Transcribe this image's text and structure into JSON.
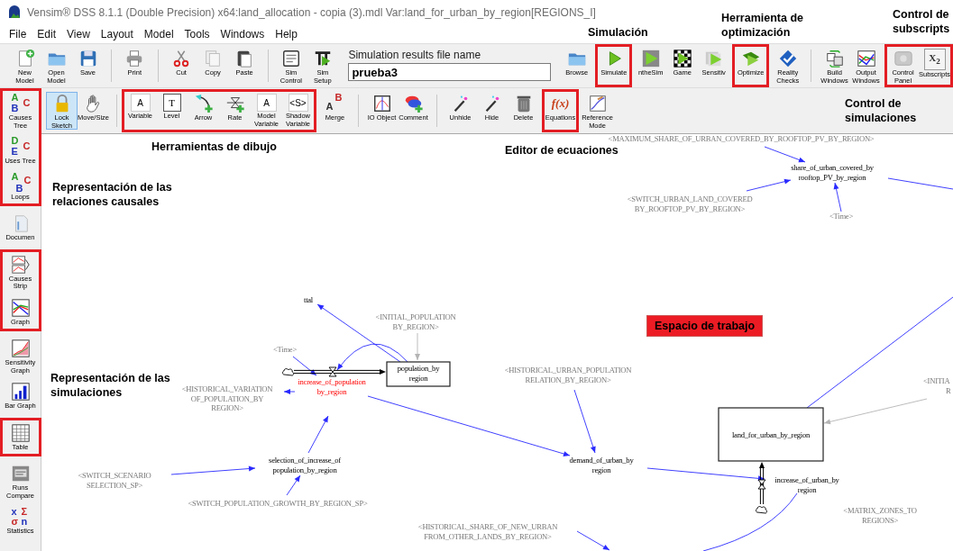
{
  "window": {
    "title": "Vensim® DSS 8.1.1 (Double Precision) x64:land_allocation - copia (3).mdl Var:land_for_urban_by_region[REGIONS_I]"
  },
  "menu": [
    "File",
    "Edit",
    "View",
    "Layout",
    "Model",
    "Tools",
    "Windows",
    "Help"
  ],
  "main_toolbar": {
    "left_groups": [
      {
        "highlighted": false,
        "items": [
          {
            "label": "New Model"
          },
          {
            "label": "Open Model"
          },
          {
            "label": "Save"
          }
        ]
      },
      {
        "highlighted": false,
        "items": [
          {
            "label": "Print"
          }
        ]
      },
      {
        "highlighted": false,
        "items": [
          {
            "label": "Cut"
          },
          {
            "label": "Copy"
          },
          {
            "label": "Paste"
          }
        ]
      },
      {
        "highlighted": false,
        "items": [
          {
            "label": "Sim Control"
          },
          {
            "label": "Sim Setup"
          }
        ]
      }
    ],
    "results_file": {
      "label": "Simulation results file name",
      "value": "prueba3"
    },
    "right_groups": [
      {
        "highlighted": false,
        "items": [
          {
            "label": "Browse"
          }
        ]
      },
      {
        "highlighted": true,
        "items": [
          {
            "label": "Simulate"
          }
        ]
      },
      {
        "highlighted": false,
        "items": [
          {
            "label": "ntheSim"
          },
          {
            "label": "Game"
          },
          {
            "label": "Sensitiv"
          }
        ]
      },
      {
        "highlighted": true,
        "items": [
          {
            "label": "Optimize"
          }
        ]
      },
      {
        "highlighted": false,
        "items": [
          {
            "label": "Reality Checks"
          }
        ]
      },
      {
        "highlighted": false,
        "items": [
          {
            "label": "Build Windows"
          },
          {
            "label": "Output Windows"
          }
        ]
      },
      {
        "highlighted": true,
        "items": [
          {
            "label": "Control Panel"
          },
          {
            "label": "Subscripts",
            "glyph": [
              "X$_{2}$"
            ]
          }
        ]
      }
    ]
  },
  "sketch_toolbar": {
    "groups": [
      {
        "highlighted": false,
        "items": [
          {
            "label": "Lock Sketch",
            "selected": true
          },
          {
            "label": "Move/Size",
            "selected": false
          }
        ]
      },
      {
        "highlighted": true,
        "items": [
          {
            "label": "Variable",
            "selected": false,
            "glyph": [
              "A"
            ]
          },
          {
            "label": "Level",
            "selected": false,
            "glyph": [
              "T"
            ]
          },
          {
            "label": "Arrow",
            "selected": false
          },
          {
            "label": "Rate",
            "selected": false
          },
          {
            "label": "Model Variable",
            "selected": false,
            "glyph": [
              "A"
            ]
          },
          {
            "label": "Shadow Variable",
            "selected": false,
            "glyph": [
              "<S>"
            ]
          }
        ]
      },
      {
        "highlighted": false,
        "items": [
          {
            "label": "Merge",
            "selected": false,
            "glyph": [
              "A",
              "B"
            ]
          }
        ]
      },
      {
        "highlighted": false,
        "items": [
          {
            "label": "IO Object",
            "selected": false
          },
          {
            "label": "Comment",
            "selected": false
          }
        ]
      },
      {
        "highlighted": false,
        "items": [
          {
            "label": "Unhide",
            "selected": false
          },
          {
            "label": "Hide",
            "selected": false
          },
          {
            "label": "Delete",
            "selected": false
          }
        ]
      },
      {
        "highlighted": true,
        "items": [
          {
            "label": "Equations",
            "selected": false,
            "glyph": [
              "f(x)"
            ]
          }
        ]
      },
      {
        "highlighted": false,
        "items": [
          {
            "label": "Reference Mode",
            "selected": false
          }
        ]
      }
    ]
  },
  "analysis_toolbar": {
    "groups": [
      {
        "highlighted": true,
        "items": [
          {
            "label": "Causes Tree",
            "glyph": [
              "A",
              "B",
              "C"
            ]
          },
          {
            "label": "Uses Tree",
            "glyph": [
              "D",
              "E",
              "C"
            ]
          },
          {
            "label": "Loops",
            "glyph": [
              "A",
              "B",
              "C"
            ]
          }
        ]
      },
      {
        "highlighted": false,
        "items": [
          {
            "label": "Documen"
          }
        ]
      },
      {
        "highlighted": true,
        "items": [
          {
            "label": "Causes Strip"
          },
          {
            "label": "Graph"
          }
        ]
      },
      {
        "highlighted": false,
        "items": [
          {
            "label": "Sensitivity Graph"
          },
          {
            "label": "Bar Graph"
          }
        ]
      },
      {
        "highlighted": true,
        "items": [
          {
            "label": "Table"
          }
        ]
      },
      {
        "highlighted": false,
        "items": [
          {
            "label": "Runs Compare"
          },
          {
            "label": "Statistics",
            "glyph": [
              "x",
              "Σ",
              "σ",
              "n"
            ]
          }
        ]
      }
    ]
  },
  "sketch": {
    "nodes": [
      {
        "kind": "shadow",
        "highlighted": false,
        "lines": [
          "<MAXIMUM_SHARE_OF_URBAN_COVERED_BY_ROOFTOP_PV_BY_REGION>"
        ]
      },
      {
        "kind": "aux",
        "highlighted": false,
        "lines": [
          "share_of_urban_covered_by",
          "rooftop_PV_by_region"
        ]
      },
      {
        "kind": "shadow",
        "highlighted": false,
        "lines": [
          "<SWITCH_URBAN_LAND_COVERED",
          "BY_ROOFTOP_PV_BY_REGION>"
        ]
      },
      {
        "kind": "shadow",
        "highlighted": false,
        "lines": [
          "<Time>"
        ]
      },
      {
        "kind": "aux",
        "highlighted": false,
        "lines": [
          "ttal"
        ]
      },
      {
        "kind": "shadow",
        "highlighted": false,
        "lines": [
          "<INITIAL_POPULATION",
          "BY_REGION>"
        ]
      },
      {
        "kind": "shadow",
        "highlighted": false,
        "lines": [
          "<Time>"
        ]
      },
      {
        "kind": "shadow",
        "highlighted": false,
        "lines": [
          "<HISTORICAL_VARIATION",
          "OF_POPULATION_BY",
          "REGION>"
        ]
      },
      {
        "kind": "rate",
        "highlighted": true,
        "lines": [
          "increase_of_population",
          "by_region"
        ]
      },
      {
        "kind": "level",
        "highlighted": false,
        "lines": [
          "population_by",
          "region"
        ]
      },
      {
        "kind": "shadow",
        "highlighted": false,
        "lines": [
          "<HISTORICAL_URBAN_POPULATION",
          "RELATION_BY_REGION>"
        ]
      },
      {
        "kind": "shadow",
        "highlighted": false,
        "lines": [
          "<INITIA",
          "R"
        ]
      },
      {
        "kind": "level",
        "highlighted": false,
        "lines": [
          "land_for_urban_by_region"
        ]
      },
      {
        "kind": "shadow",
        "highlighted": false,
        "lines": [
          "<SWITCH_SCENARIO",
          "SELECTION_SP>"
        ]
      },
      {
        "kind": "aux",
        "highlighted": false,
        "lines": [
          "selection_of_increase_of",
          "population_by_region"
        ]
      },
      {
        "kind": "aux",
        "highlighted": false,
        "lines": [
          "demand_of_urban_by",
          "region"
        ]
      },
      {
        "kind": "rate",
        "highlighted": false,
        "lines": [
          "increase_of_urban_by",
          "region"
        ]
      },
      {
        "kind": "shadow",
        "highlighted": false,
        "lines": [
          "<SWITCH_POPULATION_GROWTH_BY_REGION_SP>"
        ]
      },
      {
        "kind": "shadow",
        "highlighted": false,
        "lines": [
          "<MATRIX_ZONES_TO",
          "REGIONS>"
        ]
      },
      {
        "kind": "shadow",
        "highlighted": false,
        "lines": [
          "<HISTORICAL_SHARE_OF_NEW_URBAN",
          "FROM_OTHER_LANDS_BY_REGION>"
        ]
      }
    ]
  },
  "annotations": [
    {
      "kind": "label",
      "text": "Simulación"
    },
    {
      "kind": "label",
      "text": "Herramienta de\noptimización"
    },
    {
      "kind": "label",
      "text": "Control de\nsubscripts"
    },
    {
      "kind": "label",
      "text": "Control de\nsimulaciones"
    },
    {
      "kind": "label",
      "text": "Herramientas de dibujo"
    },
    {
      "kind": "label",
      "text": "Editor de ecuaciones"
    },
    {
      "kind": "label",
      "text": "Representación de las\nrelaciones causales"
    },
    {
      "kind": "badge",
      "text": "Espacio de trabajo"
    },
    {
      "kind": "label",
      "text": "Representación de las\nsimulaciones"
    }
  ]
}
